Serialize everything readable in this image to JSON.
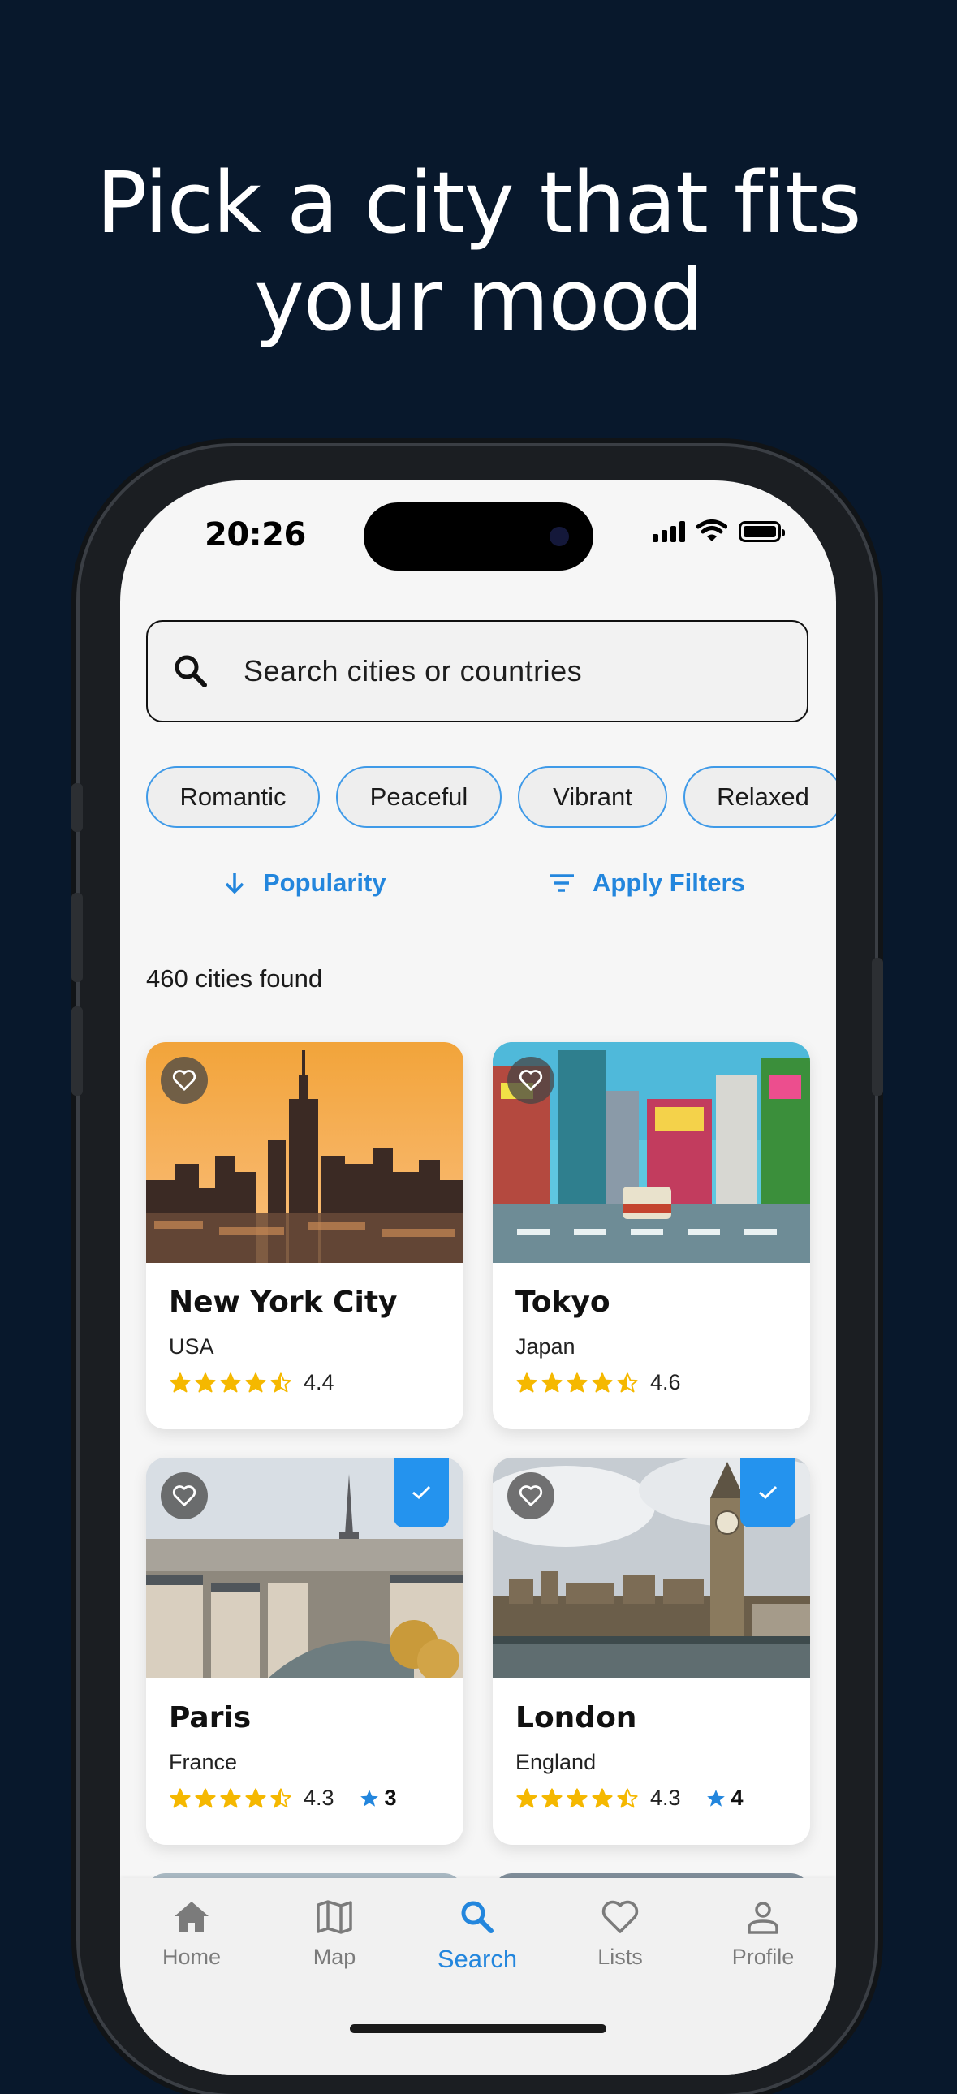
{
  "promo": {
    "headline_line1": "Pick a city that fits",
    "headline_line2": "your mood"
  },
  "status_bar": {
    "time": "20:26"
  },
  "search": {
    "placeholder": "Search cities or countries"
  },
  "mood_chips": [
    "Romantic",
    "Peaceful",
    "Vibrant",
    "Relaxed"
  ],
  "sort": {
    "label": "Popularity",
    "filter_label": "Apply Filters"
  },
  "results": {
    "count_text": "460 cities found"
  },
  "cities": [
    {
      "name": "New York City",
      "country": "USA",
      "rating": "4.4",
      "rating_value": 4.4,
      "selected": false
    },
    {
      "name": "Tokyo",
      "country": "Japan",
      "rating": "4.6",
      "rating_value": 4.6,
      "selected": false
    },
    {
      "name": "Paris",
      "country": "France",
      "rating": "4.3",
      "rating_value": 4.3,
      "user_rating": "3",
      "selected": true
    },
    {
      "name": "London",
      "country": "England",
      "rating": "4.3",
      "rating_value": 4.3,
      "user_rating": "4",
      "selected": true
    }
  ],
  "tabs": [
    {
      "label": "Home",
      "icon": "home-icon"
    },
    {
      "label": "Map",
      "icon": "map-icon"
    },
    {
      "label": "Search",
      "icon": "search-icon",
      "active": true
    },
    {
      "label": "Lists",
      "icon": "heart-icon"
    },
    {
      "label": "Profile",
      "icon": "person-icon"
    }
  ],
  "colors": {
    "accent": "#2386dd",
    "star": "#f5b800",
    "background": "#08182c",
    "chip_border": "#3f9ae8"
  }
}
